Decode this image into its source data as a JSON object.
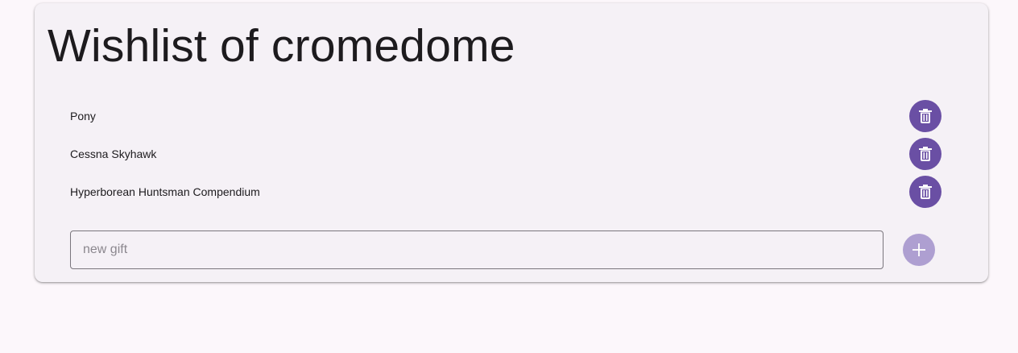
{
  "wishlist": {
    "title": "Wishlist of cromedome",
    "items": [
      {
        "label": "Pony",
        "delete_icon": "trash-icon"
      },
      {
        "label": "Cessna Skyhawk",
        "delete_icon": "trash-icon"
      },
      {
        "label": "Hyperborean Huntsman Compendium",
        "delete_icon": "trash-icon"
      }
    ],
    "new_gift": {
      "placeholder": "new gift",
      "value": "",
      "add_icon": "plus-icon"
    }
  },
  "colors": {
    "page_background": "#fcf7fb",
    "card_background": "#f5f1f6",
    "delete_button": "#6a4fa4",
    "add_button_disabled": "#ae9fd1",
    "text": "#1d1b1e"
  }
}
